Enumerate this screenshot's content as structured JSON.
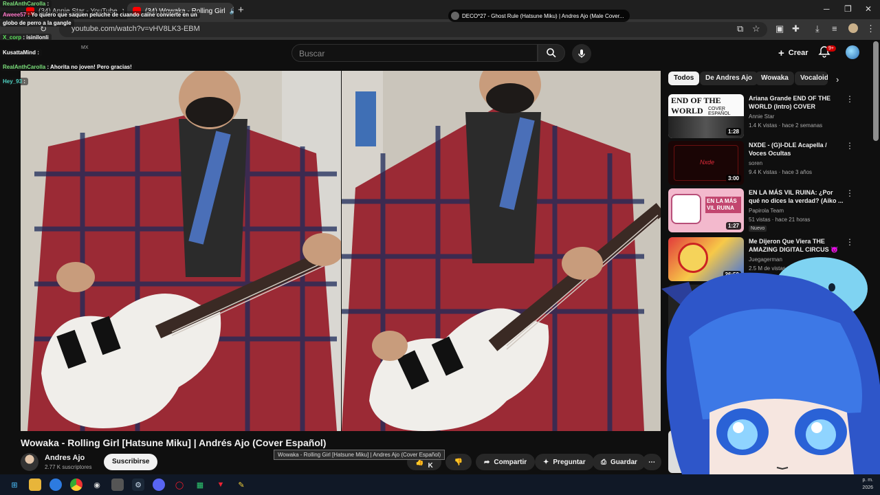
{
  "browser": {
    "tabs": [
      {
        "label": "(34) Annie Star - YouTube"
      },
      {
        "label": "(34) Wowaka - Rolling Girl"
      }
    ],
    "url": "youtube.com/watch?v=vHV8LK3-EBM"
  },
  "youtube": {
    "country": "MX",
    "search_placeholder": "Buscar",
    "create_label": "Crear",
    "notification_count": "9+"
  },
  "video": {
    "overlay_text": "DECO*27 - Ghost Rule (Hatsune Miku) | Andres Ajo (Male Cover...",
    "title": "Wowaka - Rolling Girl [Hatsune Miku] | Andrés Ajo (Cover Español)",
    "tooltip": "Wowaka - Rolling Girl [Hatsune Miku] | Andres Ajo (Cover Español)",
    "channel": "Andres Ajo",
    "subscribers": "2.77 K suscriptores",
    "subscribe_label": "Suscribirse",
    "likes": "2.3 K",
    "share_label": "Compartir",
    "ask_label": "Preguntar",
    "save_label": "Guardar"
  },
  "chips": [
    "Todos",
    "De Andres Ajo",
    "Wowaka",
    "Vocaloid"
  ],
  "recommendations": [
    {
      "title": "Ariana Grande END OF THE WORLD (Intro) COVER ESPAÑOL",
      "channel": "Annie Star",
      "meta": "1.4 K vistas · hace 2 semanas",
      "duration": "1:28",
      "thumb_text": "END OF THE WORLD",
      "thumb_sub": "COVER ESPAÑOL",
      "new": ""
    },
    {
      "title": "NXDE - (G)I-DLE Acapella / Voces Ocultas",
      "channel": "soren",
      "meta": "9.4 K vistas · hace 3 años",
      "duration": "3:00",
      "thumb_text": "Nxde",
      "thumb_sub": "",
      "new": ""
    },
    {
      "title": "EN LA MÁS VIL RUINA: ¿Por qué no dices la verdad? (Aiko ...",
      "channel": "Papirola Team",
      "meta": "51 vistas · hace 21 horas",
      "duration": "1:27",
      "thumb_text": "EN LA MÁS VIL RUINA",
      "thumb_sub": "",
      "new": "Nuevo"
    },
    {
      "title": "Me Dijeron Que Viera THE AMAZING DIGITAL CIRCUS 😈",
      "channel": "Juegagerman",
      "meta": "2.5 M de vistas",
      "duration": "26:59",
      "thumb_text": "",
      "thumb_sub": "",
      "new": ""
    }
  ],
  "chat": [
    {
      "user": "RealAnthCarolla",
      "msg": ":"
    },
    {
      "user": "Aweee57",
      "msg": ": Yo quiero que saquen peluche de cuando caine convierte en un"
    },
    {
      "user": "",
      "msg": "globo de perro a la gangle"
    },
    {
      "user": "X_corp",
      "msg": ": isinilonli"
    },
    {
      "user": "KusattaMind",
      "msg": ":"
    },
    {
      "user": "RealAnthCarolla",
      "msg": ": Ahorita no joven! Pero gracias!"
    },
    {
      "user": "Hey_93",
      "msg": ":"
    }
  ],
  "taskbar": {
    "clock_line1": "p. m.",
    "clock_line2": "2026"
  },
  "colors": {
    "background": "#0f0f0f",
    "youtube_red": "#ff0000",
    "text": "#f1f1f1",
    "muted": "#aaaaaa",
    "chip_active": "#f1f1f1"
  }
}
